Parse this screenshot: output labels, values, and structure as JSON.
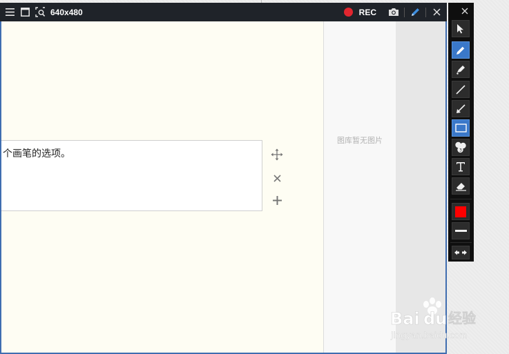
{
  "titlebar": {
    "size_label": "640x480",
    "rec_label": "REC",
    "icons": [
      "menu-icon",
      "window-icon",
      "zoom-region-icon",
      "camera-icon",
      "pen-icon",
      "close-icon"
    ]
  },
  "canvas": {
    "textbox_text": "个画笔的选项。"
  },
  "gallery": {
    "empty_text": "图库暂无图片"
  },
  "toolbar": {
    "tools": [
      "cursor-tool",
      "pencil-tool",
      "highlighter-tool",
      "line-tool",
      "arrow-tool",
      "rectangle-tool",
      "numbering-tool",
      "text-tool",
      "eraser-tool",
      "color-swatch",
      "stroke-width",
      "expand-collapse"
    ],
    "active_tools": [
      "pencil-tool",
      "rectangle-tool"
    ],
    "current_color": "#ff0000"
  },
  "colors": {
    "frame_border": "#3f6db0",
    "active_tool": "#3a78c9",
    "rec_dot": "#e2262f",
    "canvas_bg": "#fefdf3"
  },
  "watermark": {
    "line1": "Bai du 经验",
    "line2": "jingyan.baidu.com"
  }
}
